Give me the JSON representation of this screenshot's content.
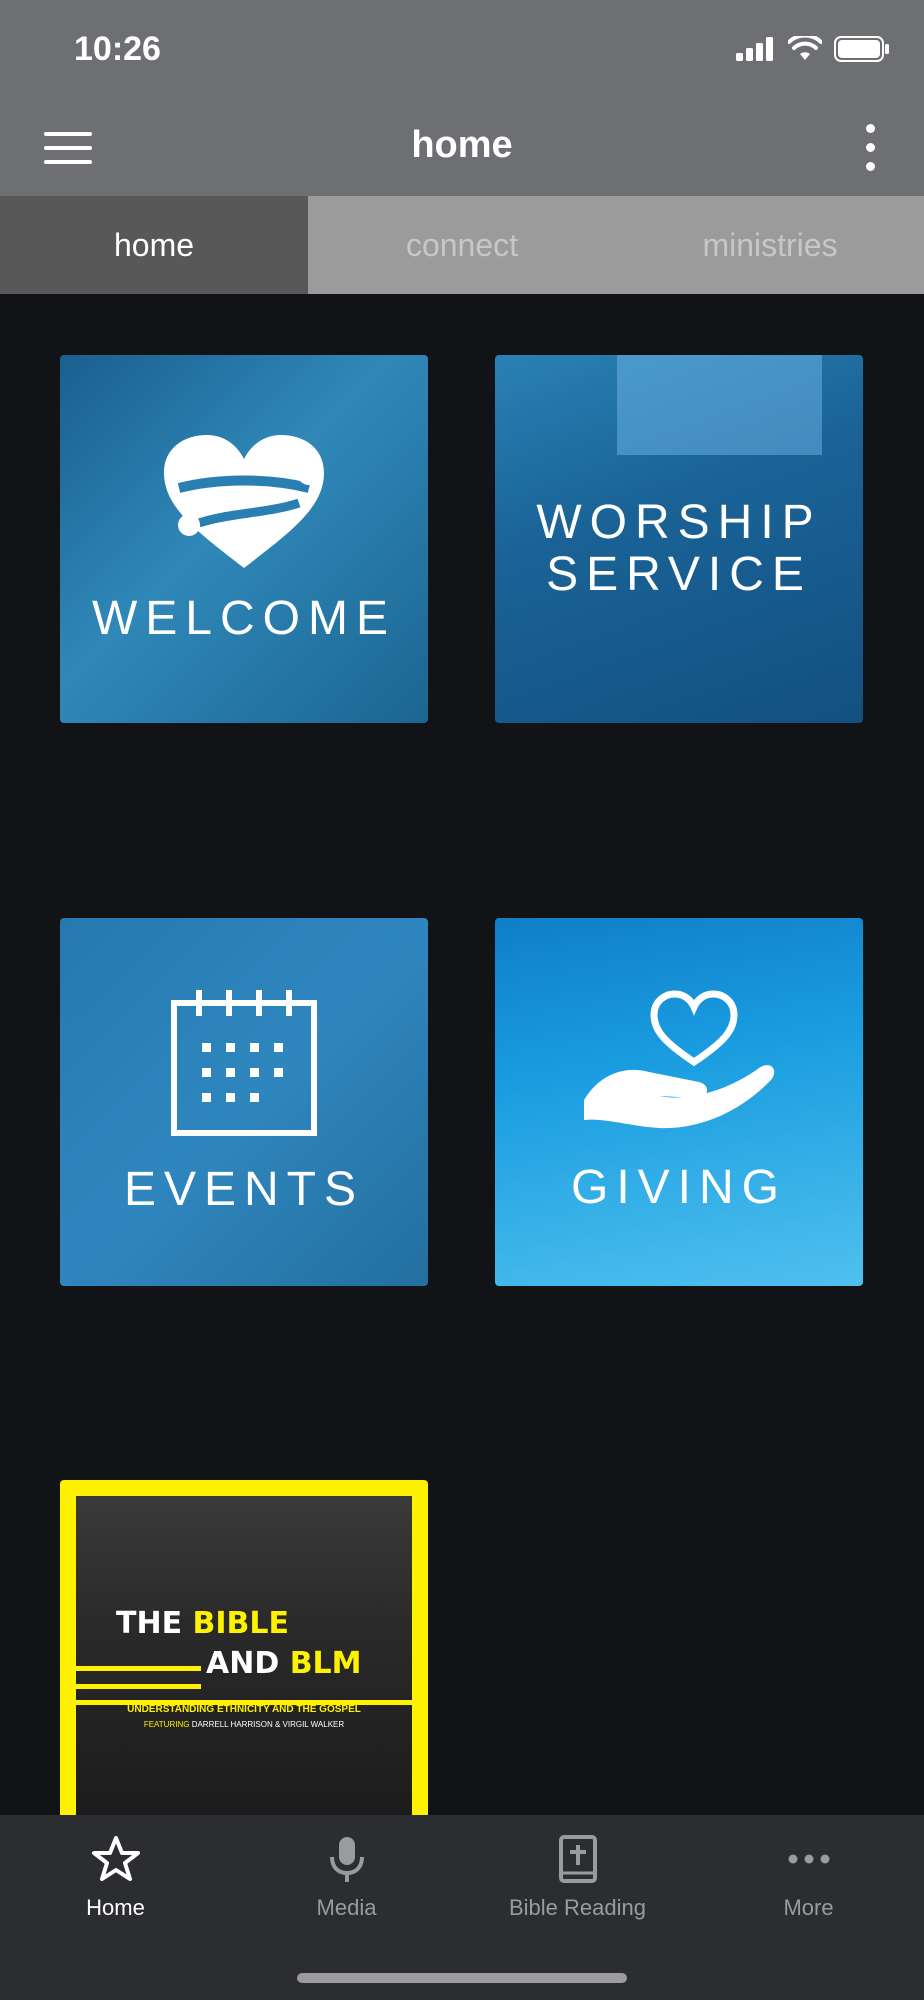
{
  "status_bar": {
    "time": "10:26"
  },
  "app_bar": {
    "title": "home"
  },
  "tabs": [
    {
      "label": "home",
      "active": true
    },
    {
      "label": "connect",
      "active": false
    },
    {
      "label": "ministries",
      "active": false
    }
  ],
  "tiles": {
    "welcome": {
      "label": "WELCOME",
      "icon": "heart-hug-icon"
    },
    "worship": {
      "line1": "WORSHIP",
      "line2": "SERVICE"
    },
    "events": {
      "label": "EVENTS",
      "icon": "calendar-icon"
    },
    "giving": {
      "label": "GIVING",
      "icon": "hand-heart-icon"
    },
    "bible_blm": {
      "word_the": "THE",
      "word_bible": "BIBLE",
      "word_and": "AND",
      "word_blm": "BLM",
      "subtitle": "UNDERSTANDING ETHNICITY AND THE GOSPEL",
      "featuring_label": "FEATURING",
      "featuring_names": "DARRELL HARRISON & VIRGIL WALKER"
    }
  },
  "bottom_nav": [
    {
      "label": "Home",
      "icon": "star-icon",
      "active": true
    },
    {
      "label": "Media",
      "icon": "microphone-icon",
      "active": false
    },
    {
      "label": "Bible Reading",
      "icon": "bible-icon",
      "active": false
    },
    {
      "label": "More",
      "icon": "more-dots-icon",
      "active": false
    }
  ],
  "colors": {
    "header_gray": "#6e6f72",
    "background": "#121316",
    "accent_yellow": "#fff200",
    "tile_blue": "#2a7fb2"
  }
}
